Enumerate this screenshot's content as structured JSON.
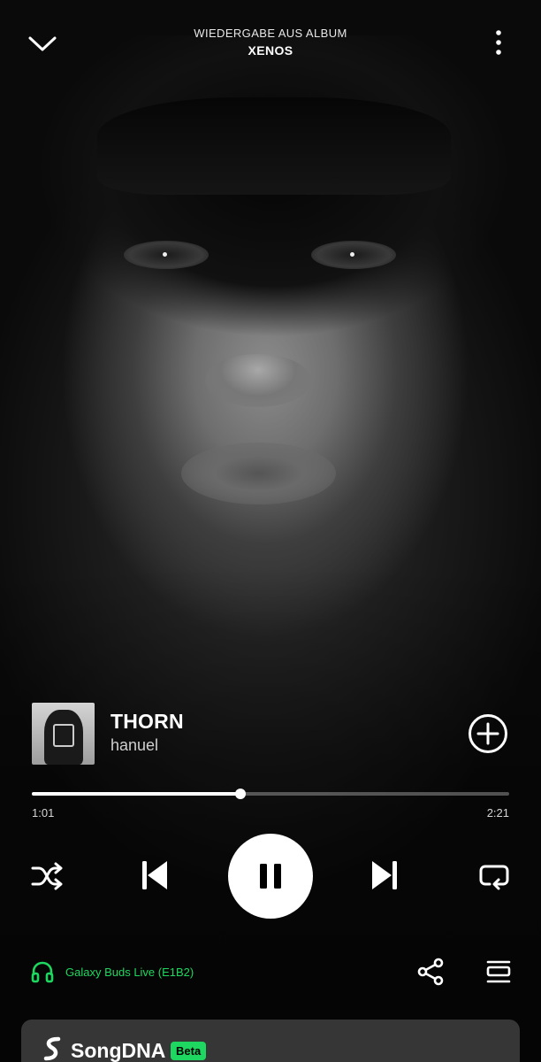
{
  "header": {
    "context_label": "WIEDERGABE AUS ALBUM",
    "context_title": "XENOS",
    "collapse_icon": "chevron-down-icon",
    "menu_icon": "more-vertical-icon"
  },
  "track": {
    "title": "THORN",
    "artist": "hanuel",
    "add_icon": "add-circle-icon"
  },
  "playback": {
    "elapsed": "1:01",
    "duration": "2:21",
    "progress_fraction": 0.437,
    "state": "playing"
  },
  "controls": {
    "shuffle_icon": "shuffle-icon",
    "previous_icon": "skip-previous-icon",
    "pause_icon": "pause-icon",
    "next_icon": "skip-next-icon",
    "repeat_icon": "repeat-icon"
  },
  "device": {
    "name": "Galaxy Buds Live (E1B2)",
    "icon": "headphones-icon",
    "color": "#1ed760"
  },
  "actions": {
    "share_icon": "share-icon",
    "queue_icon": "queue-icon"
  },
  "card": {
    "title": "SongDNA",
    "badge": "Beta",
    "logo_icon": "songdna-logo-icon",
    "accent": "#1ed760"
  }
}
